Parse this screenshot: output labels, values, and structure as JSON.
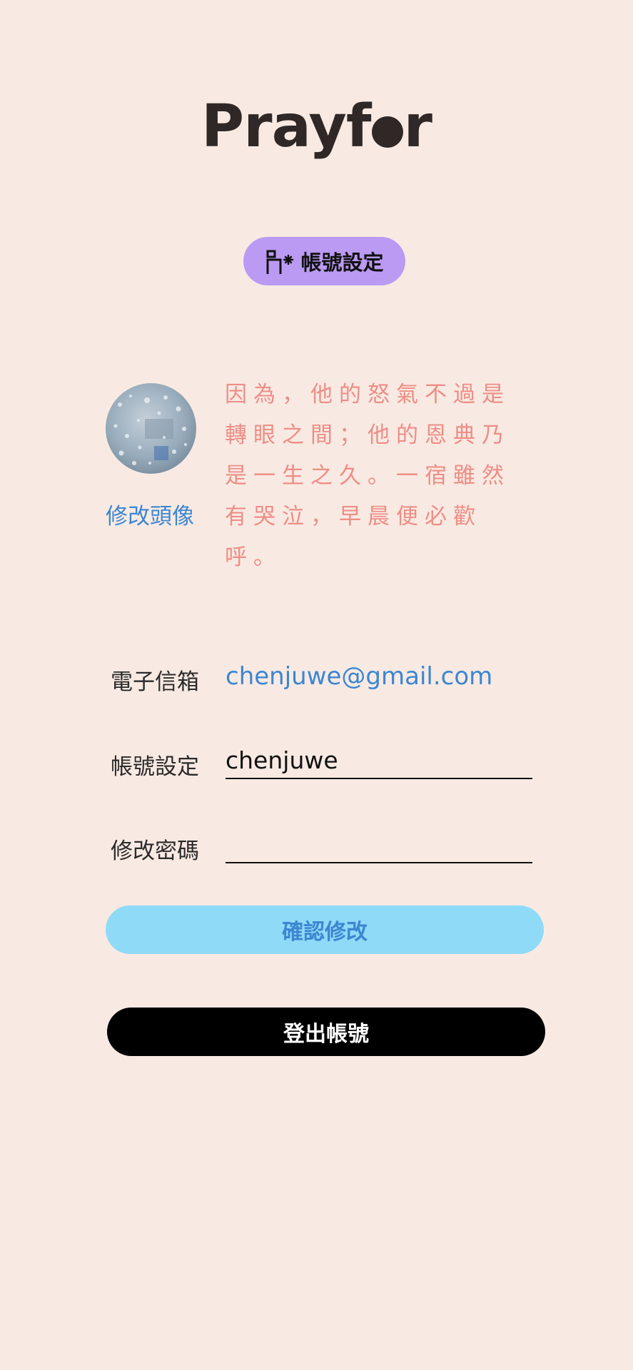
{
  "app": {
    "logo_before": "Prayf",
    "logo_after": "r"
  },
  "section": {
    "icon": "user-settings-icon",
    "title": "帳號設定",
    "color": "#bb9af3"
  },
  "profile": {
    "avatar_icon": "rain-droplets-photo",
    "change_avatar_label": "修改頭像",
    "verse": "因為，他的怒氣不過是轉眼之間；他的恩典乃是一生之久。一宿雖然有哭泣，早晨便必歡呼。"
  },
  "form": {
    "email_label": "電子信箱",
    "email_value": "chenjuwe@gmail.com",
    "account_label": "帳號設定",
    "account_value": "chenjuwe",
    "password_label": "修改密碼",
    "password_value": ""
  },
  "actions": {
    "confirm_label": "確認修改",
    "logout_label": "登出帳號"
  },
  "colors": {
    "background": "#f8eae3",
    "accent_blue": "#3c86d2",
    "verse_pink": "#ee8e86",
    "confirm_bg": "#8fdaf7"
  }
}
